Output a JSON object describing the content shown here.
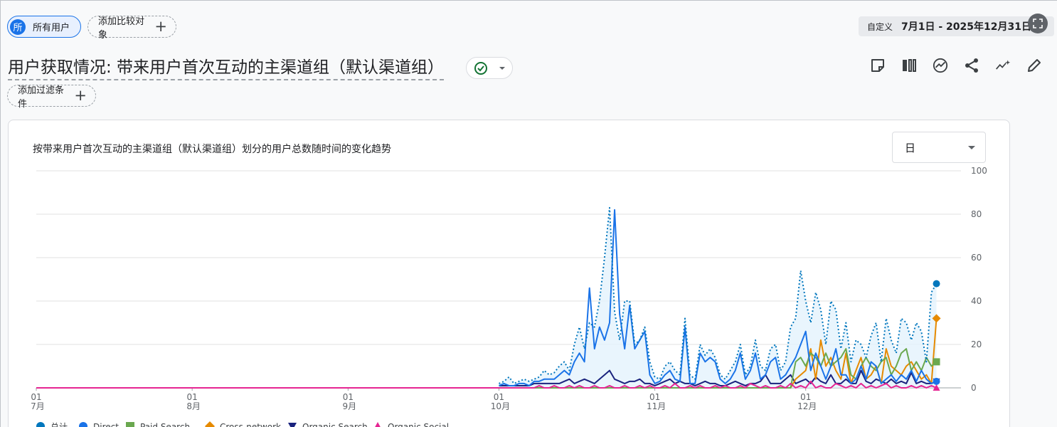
{
  "header": {
    "user_segment_label": "所有用户",
    "user_avatar_letter": "所",
    "compare_label": "添加比较对象",
    "date_custom_label": "自定义",
    "date_range": "7月1日 - 2025年12月31日"
  },
  "report": {
    "title": "用户获取情况: 带来用户首次互动的主渠道组（默认渠道组）",
    "filter_label": "添加过滤条件"
  },
  "chart_card": {
    "title": "按带来用户首次互动的主渠道组（默认渠道组）划分的用户总数随时间的变化趋势",
    "granularity": "日"
  },
  "toolbar": {
    "icons": [
      "note-icon",
      "compare-columns-icon",
      "insights-icon",
      "share-icon",
      "trend-sparkle-icon",
      "edit-icon"
    ]
  },
  "chart_data": {
    "type": "line",
    "y_ticks": [
      "0",
      "20",
      "40",
      "60",
      "80",
      "100"
    ],
    "ylim": [
      0,
      100
    ],
    "x_ticks": [
      {
        "day": "01",
        "month": "7月",
        "index": 0
      },
      {
        "day": "01",
        "month": "8月",
        "index": 31
      },
      {
        "day": "01",
        "month": "9月",
        "index": 62
      },
      {
        "day": "01",
        "month": "10月",
        "index": 92
      },
      {
        "day": "01",
        "month": "11月",
        "index": 123
      },
      {
        "day": "01",
        "month": "12月",
        "index": 153
      }
    ],
    "start_index": 92,
    "legend": [
      {
        "name": "总计",
        "color": "#0277bd",
        "marker": "circle"
      },
      {
        "name": "Direct",
        "color": "#1a73e8",
        "marker": "circle"
      },
      {
        "name": "Paid Search",
        "color": "#6aa84f",
        "marker": "square"
      },
      {
        "name": "Cross-network",
        "color": "#e68a00",
        "marker": "diamond"
      },
      {
        "name": "Organic Search",
        "color": "#1a237e",
        "marker": "triangle-down"
      },
      {
        "name": "Organic Social",
        "color": "#e52592",
        "marker": "triangle-up"
      }
    ],
    "series": [
      {
        "name": "总计",
        "color": "#0277bd",
        "dotted": true,
        "values": [
          2,
          3,
          5,
          2,
          3,
          4,
          3,
          4,
          5,
          8,
          6,
          7,
          10,
          12,
          8,
          20,
          28,
          18,
          30,
          28,
          40,
          60,
          83,
          35,
          22,
          40,
          40,
          20,
          22,
          28,
          12,
          5,
          4,
          10,
          12,
          8,
          6,
          32,
          6,
          4,
          20,
          15,
          18,
          14,
          6,
          4,
          8,
          12,
          20,
          6,
          10,
          22,
          10,
          8,
          18,
          20,
          8,
          12,
          28,
          32,
          54,
          40,
          30,
          44,
          36,
          20,
          40,
          36,
          18,
          30,
          12,
          22,
          20,
          14,
          24,
          30,
          12,
          32,
          22,
          16,
          32,
          30,
          22,
          30,
          26,
          12,
          44,
          48
        ]
      },
      {
        "name": "Direct",
        "color": "#1a73e8",
        "dotted": false,
        "values": [
          1,
          2,
          1,
          1,
          2,
          2,
          1,
          3,
          3,
          4,
          4,
          4,
          6,
          8,
          6,
          12,
          16,
          12,
          46,
          18,
          28,
          22,
          30,
          82,
          34,
          18,
          38,
          18,
          22,
          26,
          6,
          2,
          3,
          6,
          8,
          4,
          3,
          28,
          2,
          2,
          16,
          12,
          14,
          12,
          4,
          2,
          4,
          8,
          16,
          4,
          8,
          16,
          4,
          6,
          12,
          14,
          4,
          6,
          10,
          14,
          20,
          26,
          8,
          16,
          10,
          4,
          10,
          18,
          6,
          6,
          2,
          4,
          10,
          4,
          12,
          10,
          2,
          4,
          6,
          3,
          6,
          4,
          8,
          3,
          8,
          4,
          2,
          3
        ]
      },
      {
        "name": "Paid Search",
        "color": "#6aa84f",
        "dotted": false,
        "values": [
          0,
          0,
          0,
          0,
          0,
          0,
          0,
          0,
          0,
          0,
          0,
          0,
          0,
          0,
          0,
          0,
          0,
          0,
          0,
          0,
          0,
          0,
          0,
          0,
          0,
          0,
          0,
          0,
          0,
          0,
          0,
          0,
          0,
          0,
          0,
          0,
          0,
          0,
          0,
          0,
          0,
          0,
          0,
          0,
          0,
          0,
          0,
          0,
          0,
          0,
          0,
          0,
          0,
          0,
          0,
          0,
          0,
          0,
          0,
          12,
          14,
          10,
          16,
          14,
          10,
          16,
          10,
          12,
          14,
          18,
          6,
          4,
          10,
          14,
          10,
          8,
          12,
          14,
          6,
          10,
          16,
          18,
          8,
          12,
          8,
          14,
          10,
          12
        ]
      },
      {
        "name": "Cross-network",
        "color": "#e68a00",
        "dotted": false,
        "values": [
          0,
          0,
          0,
          0,
          0,
          0,
          0,
          0,
          0,
          0,
          0,
          0,
          0,
          0,
          0,
          0,
          0,
          0,
          0,
          0,
          0,
          0,
          0,
          0,
          0,
          0,
          0,
          0,
          0,
          0,
          0,
          0,
          0,
          0,
          0,
          0,
          0,
          0,
          0,
          0,
          0,
          0,
          0,
          0,
          0,
          0,
          0,
          0,
          0,
          0,
          0,
          0,
          0,
          0,
          0,
          0,
          0,
          0,
          0,
          4,
          6,
          8,
          18,
          4,
          22,
          10,
          14,
          8,
          4,
          16,
          2,
          8,
          14,
          4,
          6,
          10,
          2,
          18,
          10,
          8,
          6,
          10,
          12,
          8,
          4,
          6,
          2,
          32
        ]
      },
      {
        "name": "Organic Search",
        "color": "#1a237e",
        "dotted": false,
        "values": [
          1,
          1,
          1,
          1,
          1,
          1,
          1,
          2,
          2,
          2,
          2,
          2,
          2,
          3,
          4,
          2,
          3,
          4,
          3,
          2,
          4,
          6,
          8,
          4,
          3,
          2,
          3,
          3,
          4,
          2,
          2,
          1,
          2,
          3,
          4,
          2,
          3,
          2,
          2,
          1,
          2,
          3,
          2,
          2,
          1,
          1,
          2,
          3,
          2,
          1,
          2,
          2,
          3,
          6,
          2,
          2,
          2,
          4,
          6,
          2,
          3,
          4,
          2,
          5,
          3,
          2,
          6,
          2,
          2,
          4,
          2,
          2,
          8,
          3,
          2,
          4,
          3,
          2,
          4,
          2,
          3,
          2,
          7,
          2,
          3,
          2,
          2,
          3
        ]
      },
      {
        "name": "Organic Social",
        "color": "#e52592",
        "dotted": false,
        "values": [
          0,
          0,
          0,
          0,
          0,
          0,
          0,
          0,
          1,
          0,
          0,
          1,
          0,
          0,
          1,
          0,
          1,
          0,
          0,
          1,
          0,
          0,
          1,
          0,
          0,
          1,
          0,
          0,
          1,
          0,
          1,
          0,
          0,
          1,
          0,
          2,
          0,
          0,
          1,
          0,
          1,
          0,
          0,
          1,
          0,
          1,
          0,
          0,
          1,
          0,
          2,
          1,
          0,
          1,
          0,
          0,
          1,
          0,
          2,
          0,
          1,
          0,
          3,
          0,
          1,
          0,
          0,
          2,
          1,
          0,
          1,
          0,
          2,
          0,
          1,
          0,
          1,
          2,
          0,
          1,
          0,
          0,
          1,
          0,
          1,
          0,
          1,
          0
        ]
      }
    ]
  }
}
